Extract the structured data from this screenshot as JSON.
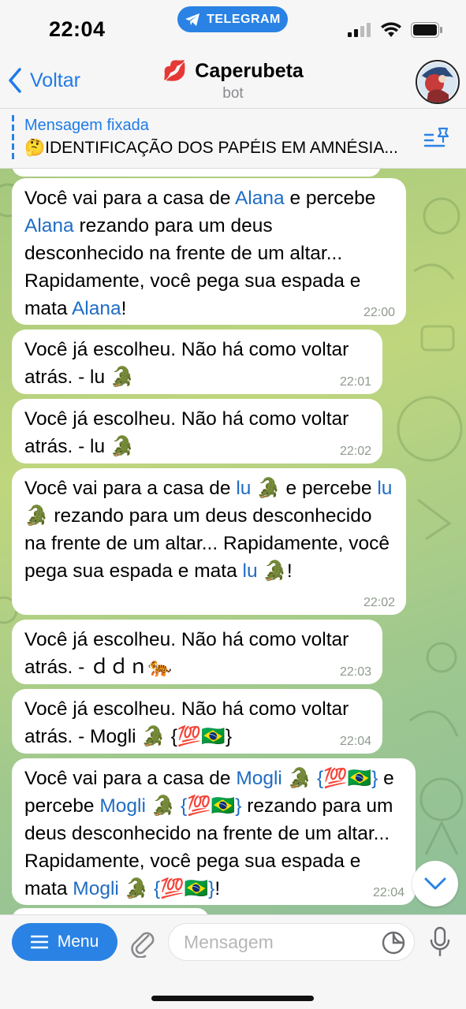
{
  "status": {
    "time": "22:04",
    "pill": "TELEGRAM"
  },
  "header": {
    "back_label": "Voltar",
    "title_emoji": "💋",
    "title": "Caperubeta",
    "subtitle": "bot"
  },
  "pinned": {
    "title": "Mensagem fixada",
    "text": "🤔IDENTIFICAÇÃO DOS PAPÉIS EM AMNÉSIA..."
  },
  "messages": [
    {
      "time": "22:00",
      "parts": [
        "Você vai para a casa de ",
        "Alana",
        " e percebe ",
        "Alana",
        " rezando para um deus desconhecido na frente de um altar... Rapidamente, você pega sua espada e mata ",
        "Alana",
        "!"
      ]
    },
    {
      "time": "22:01",
      "parts": [
        "Você já escolheu. Não há como voltar atrás. - lu 🐊"
      ]
    },
    {
      "time": "22:02",
      "parts": [
        "Você já escolheu. Não há como voltar atrás. - lu 🐊"
      ]
    },
    {
      "time": "22:02",
      "parts": [
        "Você vai para a casa de ",
        "lu 🐊",
        " e percebe ",
        "lu 🐊",
        " rezando para um deus desconhecido na frente de um altar... Rapidamente, você pega sua espada e mata ",
        "lu 🐊",
        "!"
      ]
    },
    {
      "time": "22:03",
      "parts": [
        "Você já escolheu. Não há como voltar atrás. - ",
        "ｄｄｎ🐅"
      ]
    },
    {
      "time": "22:04",
      "parts": [
        "Você já escolheu. Não há como voltar atrás. - Mogli 🐊 {💯🇧🇷}"
      ]
    },
    {
      "time": "22:04",
      "parts": [
        "Você vai para a casa de ",
        "Mogli 🐊 {💯🇧🇷}",
        " e percebe ",
        "Mogli 🐊 {💯🇧🇷}",
        " rezando para um deus desconhecido na frente de um altar... Rapidamente, você pega sua espada e mata ",
        "Mogli 🐊 {💯🇧🇷}",
        "!"
      ]
    }
  ],
  "input": {
    "menu_label": "Menu",
    "placeholder": "Mensagem"
  },
  "colors": {
    "accent": "#2a82e4",
    "link": "#1f6cc4",
    "chat_bg": "#b5d07f"
  }
}
